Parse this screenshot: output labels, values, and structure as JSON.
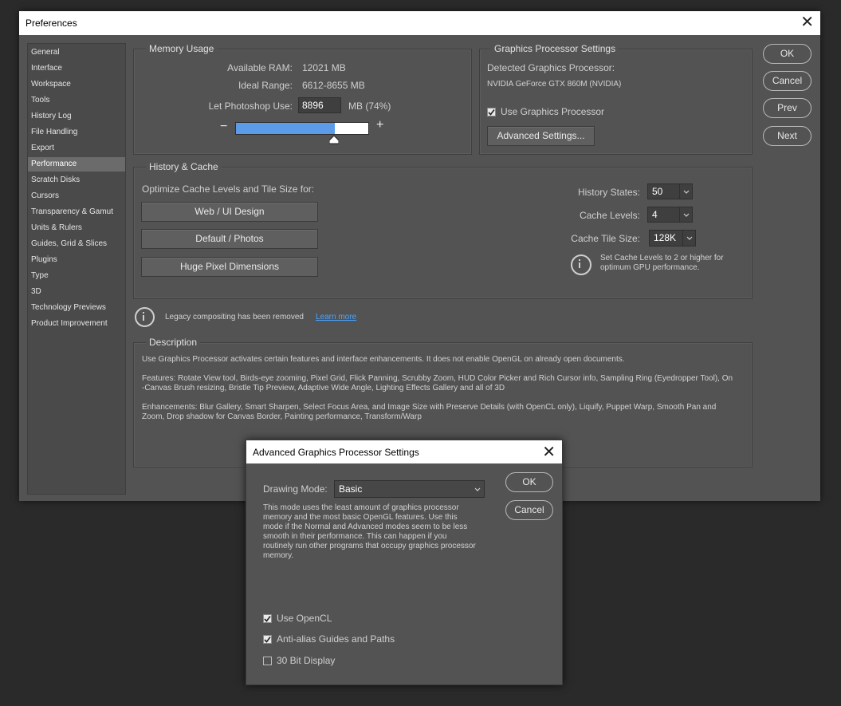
{
  "prefs": {
    "title": "Preferences",
    "sidebar": [
      "General",
      "Interface",
      "Workspace",
      "Tools",
      "History Log",
      "File Handling",
      "Export",
      "Performance",
      "Scratch Disks",
      "Cursors",
      "Transparency & Gamut",
      "Units & Rulers",
      "Guides, Grid & Slices",
      "Plugins",
      "Type",
      "3D",
      "Technology Previews",
      "Product Improvement"
    ],
    "active_index": 7,
    "buttons": {
      "ok": "OK",
      "cancel": "Cancel",
      "prev": "Prev",
      "next": "Next"
    },
    "memory": {
      "title": "Memory Usage",
      "available_label": "Available RAM:",
      "available_value": "12021 MB",
      "ideal_label": "Ideal Range:",
      "ideal_value": "6612-8655 MB",
      "let_label": "Let Photoshop Use:",
      "let_value": "8896",
      "let_suffix": "MB (74%)",
      "minus": "−",
      "plus": "+",
      "slider_fraction": 0.74
    },
    "gpu": {
      "title": "Graphics Processor Settings",
      "detected_label": "Detected Graphics Processor:",
      "detected_value": "NVIDIA GeForce GTX 860M (NVIDIA)",
      "use_label": "Use Graphics Processor",
      "use_checked": true,
      "advanced_button": "Advanced Settings..."
    },
    "history": {
      "title": "History & Cache",
      "optimize_label": "Optimize Cache Levels and Tile Size for:",
      "btn_web": "Web / UI Design",
      "btn_default": "Default / Photos",
      "btn_huge": "Huge Pixel Dimensions",
      "states_label": "History States:",
      "states_value": "50",
      "levels_label": "Cache Levels:",
      "levels_value": "4",
      "tile_label": "Cache Tile Size:",
      "tile_value": "128K",
      "info_line1": "Set Cache Levels to 2 or higher for",
      "info_line2": "optimum GPU performance."
    },
    "legacy": {
      "text": "Legacy compositing has been removed",
      "link": "Learn more"
    },
    "description": {
      "title": "Description",
      "p1": "Use Graphics Processor activates certain features and interface enhancements. It does not enable OpenGL on already open documents.",
      "p2a": "Features: Rotate View tool, Birds-eye zooming, Pixel Grid, Flick Panning, Scrubby Zoom, HUD Color Picker and Rich Cursor info, Sampling Ring (Eyedropper Tool), On",
      "p2b": "-Canvas Brush resizing, Bristle Tip Preview, Adaptive Wide Angle, Lighting Effects Gallery and all of 3D",
      "p3a": "Enhancements: Blur Gallery, Smart Sharpen, Select Focus Area, and Image Size with Preserve Details (with OpenCL only), Liquify, Puppet Warp, Smooth Pan and",
      "p3b": "Zoom, Drop shadow for Canvas Border, Painting performance, Transform/Warp"
    }
  },
  "dialog": {
    "title": "Advanced Graphics Processor Settings",
    "mode_label": "Drawing Mode:",
    "mode_value": "Basic",
    "ok": "OK",
    "cancel": "Cancel",
    "desc_lines": [
      "This mode uses the least amount of graphics processor",
      "memory and the most basic OpenGL features.  Use this",
      "mode if the Normal and Advanced modes seem to be less",
      "smooth in their performance.  This can happen if you",
      "routinely run other programs that occupy graphics processor",
      "memory."
    ],
    "opencl_label": "Use OpenCL",
    "opencl_checked": true,
    "antialias_label": "Anti-alias Guides and Paths",
    "antialias_checked": true,
    "bit30_label": "30 Bit Display",
    "bit30_checked": false
  }
}
